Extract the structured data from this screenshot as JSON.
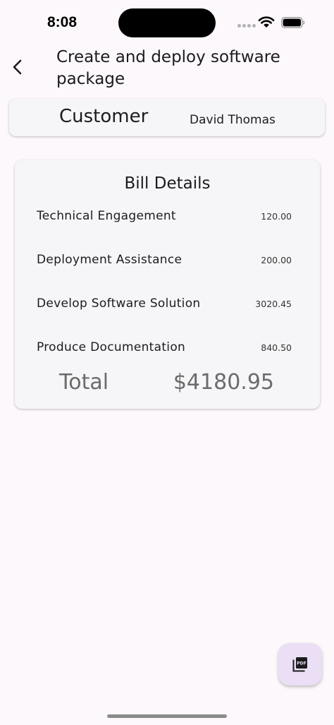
{
  "status_bar": {
    "time": "8:08"
  },
  "header": {
    "title": "Create and deploy software package"
  },
  "customer": {
    "label": "Customer",
    "name": "David Thomas"
  },
  "bill": {
    "title": "Bill Details",
    "items": [
      {
        "name": "Technical Engagement",
        "amount": "120.00"
      },
      {
        "name": "Deployment Assistance",
        "amount": "200.00"
      },
      {
        "name": "Develop Software Solution",
        "amount": "3020.45"
      },
      {
        "name": "Produce Documentation",
        "amount": "840.50"
      }
    ],
    "total_label": "Total",
    "total_value": "$4180.95"
  },
  "fab": {
    "icon": "pdf-icon"
  }
}
